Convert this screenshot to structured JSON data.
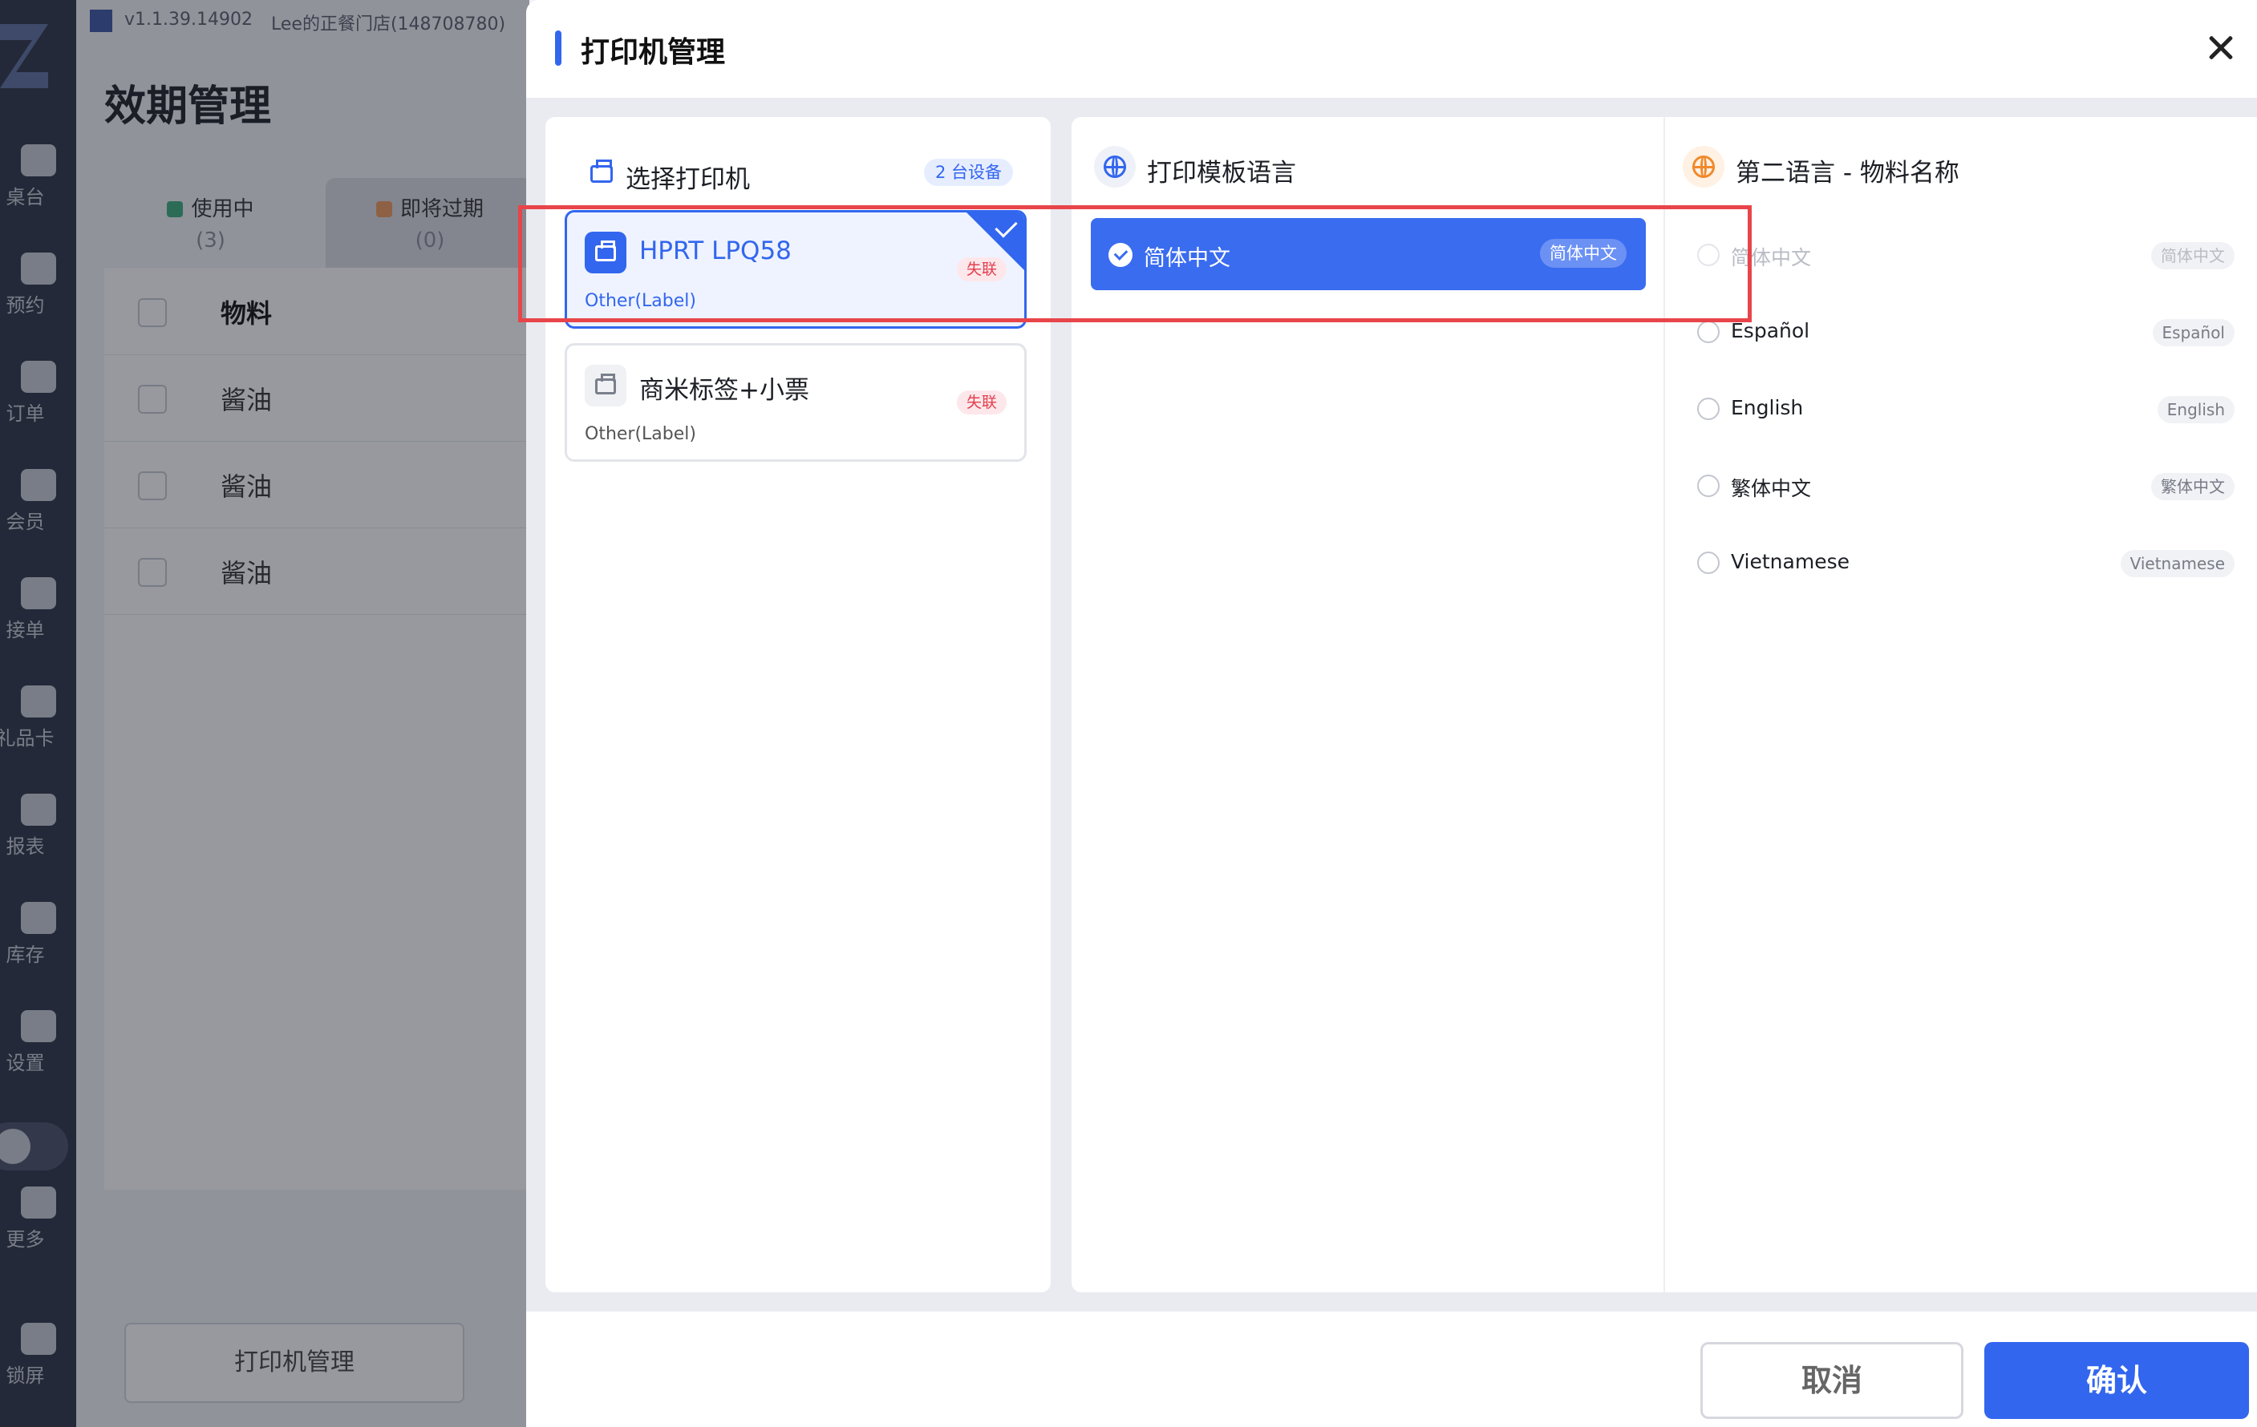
{
  "app": {
    "version": "v1.1.39.14902",
    "store_name": "Lee的正餐门店(148708780)"
  },
  "sidebar": {
    "items": [
      {
        "label": "桌台",
        "icon": "table-icon"
      },
      {
        "label": "预约",
        "icon": "reservation-icon"
      },
      {
        "label": "订单",
        "icon": "order-icon"
      },
      {
        "label": "会员",
        "icon": "member-icon"
      },
      {
        "label": "接单",
        "icon": "accept-order-icon"
      },
      {
        "label": "礼品卡",
        "icon": "gift-card-icon"
      },
      {
        "label": "报表",
        "icon": "report-icon"
      },
      {
        "label": "库存",
        "icon": "inventory-icon"
      },
      {
        "label": "设置",
        "icon": "settings-icon"
      },
      {
        "label": "更多",
        "icon": "more-icon"
      },
      {
        "label": "锁屏",
        "icon": "lock-icon"
      }
    ]
  },
  "page": {
    "title": "效期管理",
    "tabs": [
      {
        "label": "使用中",
        "count": "(3)",
        "color": "#3cae7e"
      },
      {
        "label": "即将过期",
        "count": "(0)",
        "color": "#f09a5b"
      }
    ],
    "table": {
      "header": "物料",
      "rows": [
        "酱油",
        "酱油",
        "酱油"
      ]
    },
    "print_manage_button": "打印机管理"
  },
  "dialog": {
    "title": "打印机管理",
    "printers_section": {
      "title": "选择打印机",
      "badge": "2 台设备",
      "printers": [
        {
          "name": "HPRT LPQ58",
          "type": "Other(Label)",
          "status": "失联",
          "selected": true
        },
        {
          "name": "商米标签+小票",
          "type": "Other(Label)",
          "status": "失联",
          "selected": false
        }
      ]
    },
    "template_section": {
      "title": "打印模板语言",
      "selected": {
        "label": "简体中文",
        "tag": "简体中文"
      }
    },
    "second_language_section": {
      "title": "第二语言 - 物料名称",
      "options": [
        {
          "label": "简体中文",
          "tag": "简体中文",
          "disabled": true
        },
        {
          "label": "Español",
          "tag": "Español",
          "disabled": false
        },
        {
          "label": "English",
          "tag": "English",
          "disabled": false
        },
        {
          "label": "繁体中文",
          "tag": "繁体中文",
          "disabled": false
        },
        {
          "label": "Vietnamese",
          "tag": "Vietnamese",
          "disabled": false
        }
      ]
    },
    "footer": {
      "cancel": "取消",
      "confirm": "确认"
    }
  },
  "colors": {
    "accent": "#3366ee",
    "danger": "#e3404f",
    "highlight_box": "#e8454a"
  }
}
